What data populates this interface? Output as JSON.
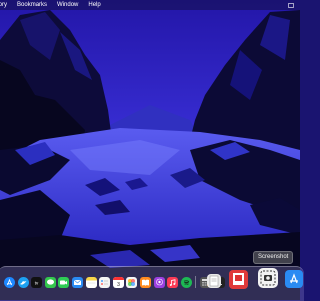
{
  "menubar": {
    "items": [
      "tory",
      "Bookmarks",
      "Window",
      "Help"
    ]
  },
  "tooltip": {
    "label": "Screenshot"
  },
  "dock": {
    "apps": [
      {
        "name": "app-store-icon",
        "color": "#1e88ff"
      },
      {
        "name": "twitter-icon",
        "color": "#1da1f2"
      },
      {
        "name": "apple-tv-icon",
        "color": "#111111",
        "glyph": "tv"
      },
      {
        "name": "messages-icon",
        "color": "#33c64d"
      },
      {
        "name": "facetime-icon",
        "color": "#2ecc55"
      },
      {
        "name": "mail-icon",
        "color": "#2a8bf2"
      },
      {
        "name": "notes-icon",
        "color": "#f7d64a"
      },
      {
        "name": "reminders-icon",
        "color": "#f4f4f4"
      },
      {
        "name": "calendar-icon",
        "color": "#ffffff"
      },
      {
        "name": "photos-icon",
        "color": "#f5f5f5"
      },
      {
        "name": "books-icon",
        "color": "#ff8a1e"
      },
      {
        "name": "podcasts-icon",
        "color": "#9b3fe0"
      },
      {
        "name": "music-icon",
        "color": "#fa3a55"
      },
      {
        "name": "spotify-icon",
        "color": "#1db954"
      },
      {
        "name": "calculator-icon",
        "color": "#555555"
      },
      {
        "name": "terminal-icon",
        "color": "#222222"
      }
    ]
  }
}
